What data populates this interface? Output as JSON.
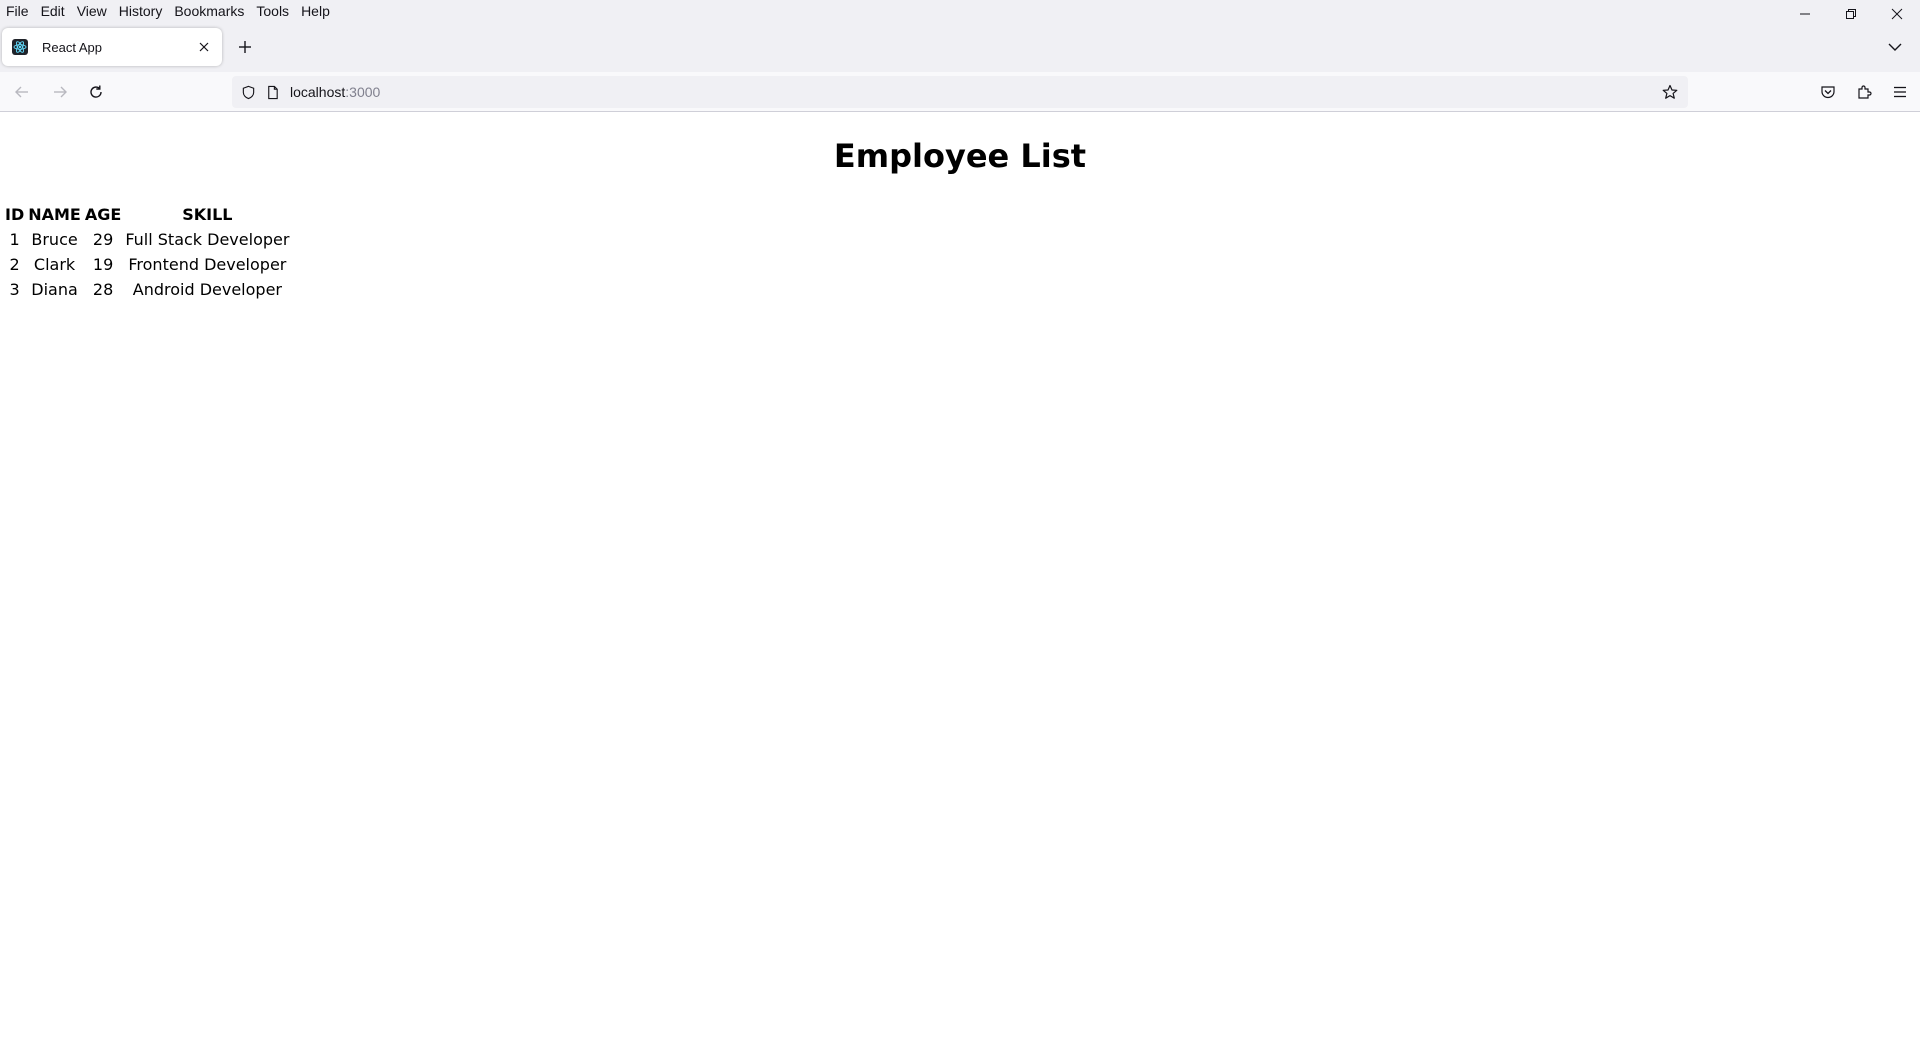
{
  "menu": [
    "File",
    "Edit",
    "View",
    "History",
    "Bookmarks",
    "Tools",
    "Help"
  ],
  "tab": {
    "title": "React App",
    "favicon": "react-icon"
  },
  "address": {
    "host": "localhost",
    "port": ":3000"
  },
  "page": {
    "title": "Employee List",
    "columns": [
      "ID",
      "NAME",
      "AGE",
      "SKILL"
    ],
    "rows": [
      [
        "1",
        "Bruce",
        "29",
        "Full Stack Developer"
      ],
      [
        "2",
        "Clark",
        "19",
        "Frontend Developer"
      ],
      [
        "3",
        "Diana",
        "28",
        "Android Developer"
      ]
    ]
  },
  "colors": {
    "chrome_bg": "#f0f0f4",
    "toolbar_bg": "#f9f9fb",
    "urlbar_bg": "#f0f0f4",
    "text": "#15141a"
  }
}
